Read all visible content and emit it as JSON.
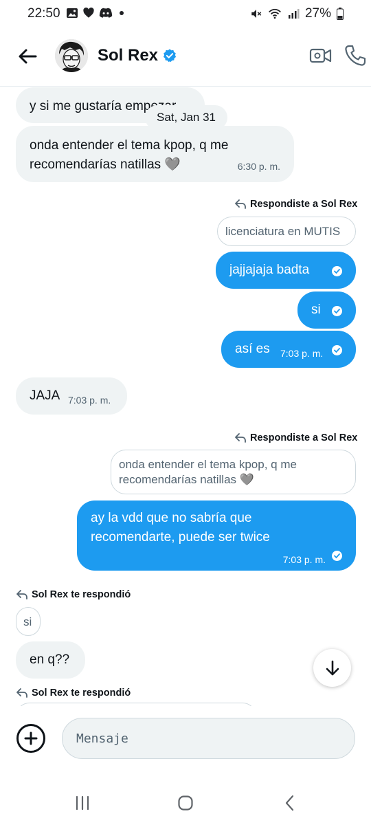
{
  "status_bar": {
    "time": "22:50",
    "battery": "27%"
  },
  "header": {
    "name": "Sol Rex"
  },
  "chat": {
    "date_separator": "Sat, Jan 31",
    "m1_text": "y si me gustaría empezar",
    "m2_line1": "onda entender el tema kpop, q me",
    "m2_line2": "recomendarías natillas 🩶",
    "m2_time": "6:30 p. m.",
    "reply1_note": "Respondiste a Sol Rex",
    "reply1_quote": "licenciatura en MUTIS",
    "m3_text": "jajjajaja badta",
    "m4_text": "si",
    "m5_text": "así es",
    "m5_time": "7:03 p. m.",
    "m6_text": "JAJA",
    "m6_time": "7:03 p. m.",
    "reply2_note": "Respondiste a Sol Rex",
    "reply2_quote_line1": "onda entender el tema kpop, q me",
    "reply2_quote_line2": "recomendarías natillas 🩶",
    "m7_line1": "ay la vdd que no sabría que",
    "m7_line2": "recomendarte, puede ser twice",
    "m7_time": "7:03 p. m.",
    "reply3_note": "Sol Rex te respondió",
    "reply3_quote": "si",
    "m8_text": "en q??",
    "reply4_note": "Sol Rex te respondió"
  },
  "composer": {
    "placeholder": "Mensaje"
  },
  "colors": {
    "accent": "#1d9bf0",
    "incoming_bubble": "#eff3f4",
    "text": "#0f1419"
  }
}
